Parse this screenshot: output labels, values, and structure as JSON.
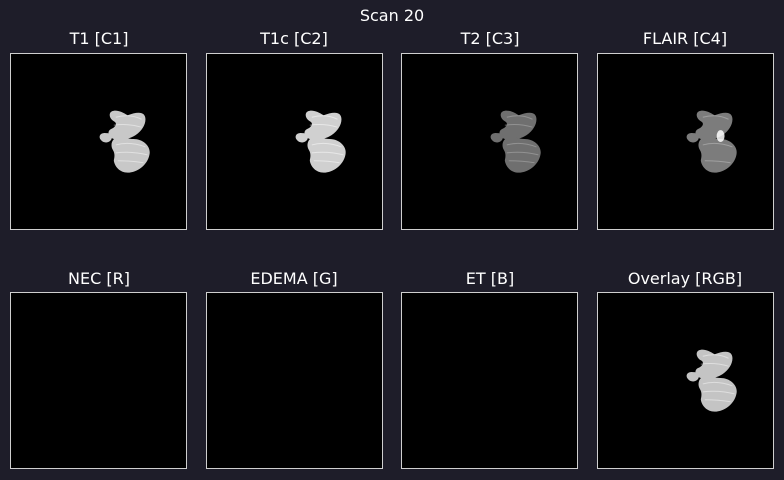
{
  "figure": {
    "title": "Scan 20"
  },
  "panels": {
    "c1": {
      "title": "T1 [C1]",
      "content": "t1-brain-slice"
    },
    "c2": {
      "title": "T1c [C2]",
      "content": "t1c-brain-slice"
    },
    "c3": {
      "title": "T2 [C3]",
      "content": "t2-brain-slice"
    },
    "c4": {
      "title": "FLAIR [C4]",
      "content": "flair-brain-slice"
    },
    "r": {
      "title": "NEC [R]",
      "content": "empty-mask"
    },
    "g": {
      "title": "EDEMA [G]",
      "content": "empty-mask"
    },
    "b": {
      "title": "ET [B]",
      "content": "empty-mask"
    },
    "rgb": {
      "title": "Overlay [RGB]",
      "content": "overlay-brain-slice"
    }
  },
  "colors": {
    "background": "#1e1d29",
    "panel_fill": "#000000",
    "panel_border": "#cfcfcf",
    "text": "#ffffff"
  }
}
